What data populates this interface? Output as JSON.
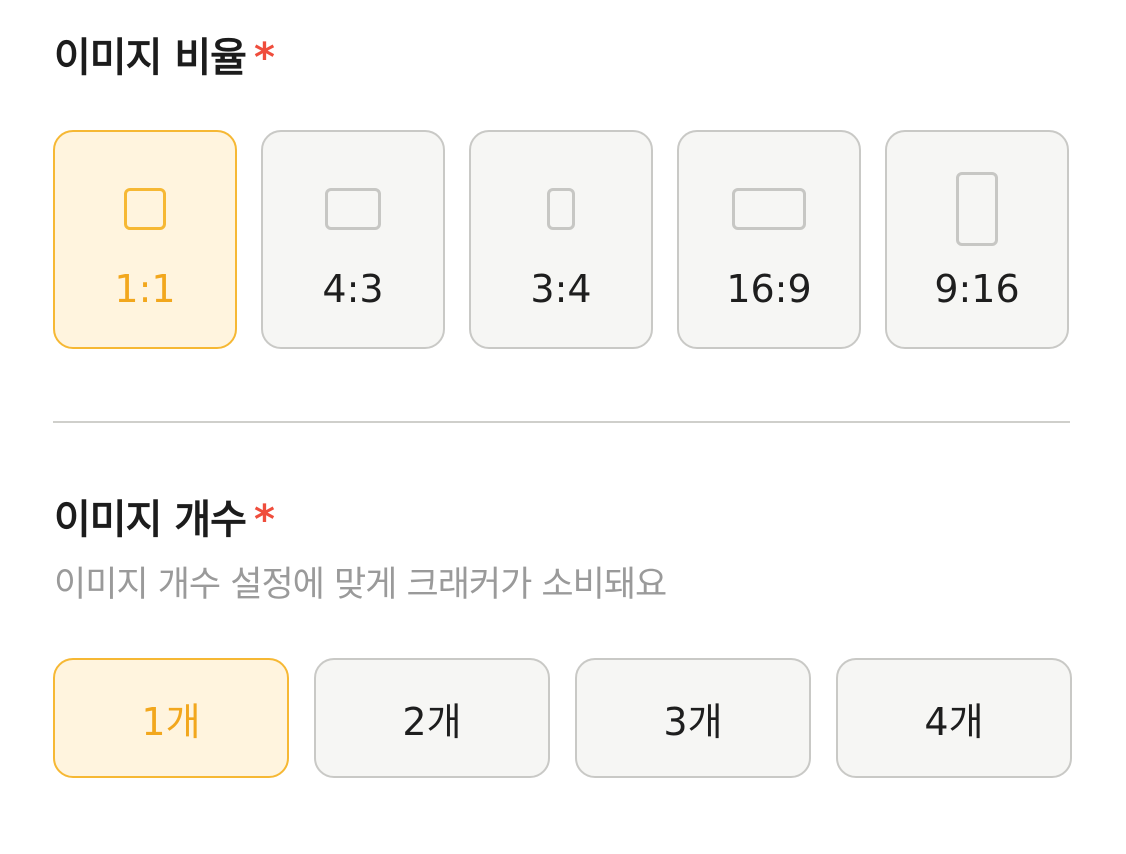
{
  "ratio_section": {
    "title": "이미지 비율",
    "required_mark": "*",
    "options": [
      {
        "label": "1:1",
        "icon": "square-ratio-icon",
        "selected": true
      },
      {
        "label": "4:3",
        "icon": "landscape-ratio-icon",
        "selected": false
      },
      {
        "label": "3:4",
        "icon": "portrait-ratio-icon",
        "selected": false
      },
      {
        "label": "16:9",
        "icon": "wide-ratio-icon",
        "selected": false
      },
      {
        "label": "9:16",
        "icon": "tall-ratio-icon",
        "selected": false
      }
    ]
  },
  "count_section": {
    "title": "이미지 개수",
    "required_mark": "*",
    "description": "이미지 개수 설정에 맞게 크래커가 소비돼요",
    "options": [
      {
        "label": "1개",
        "selected": true
      },
      {
        "label": "2개",
        "selected": false
      },
      {
        "label": "3개",
        "selected": false
      },
      {
        "label": "4개",
        "selected": false
      }
    ]
  },
  "colors": {
    "accent": "#f6b834",
    "accent_text": "#f2a71d",
    "selected_bg": "#fff4de",
    "required": "#ef4d3c"
  }
}
